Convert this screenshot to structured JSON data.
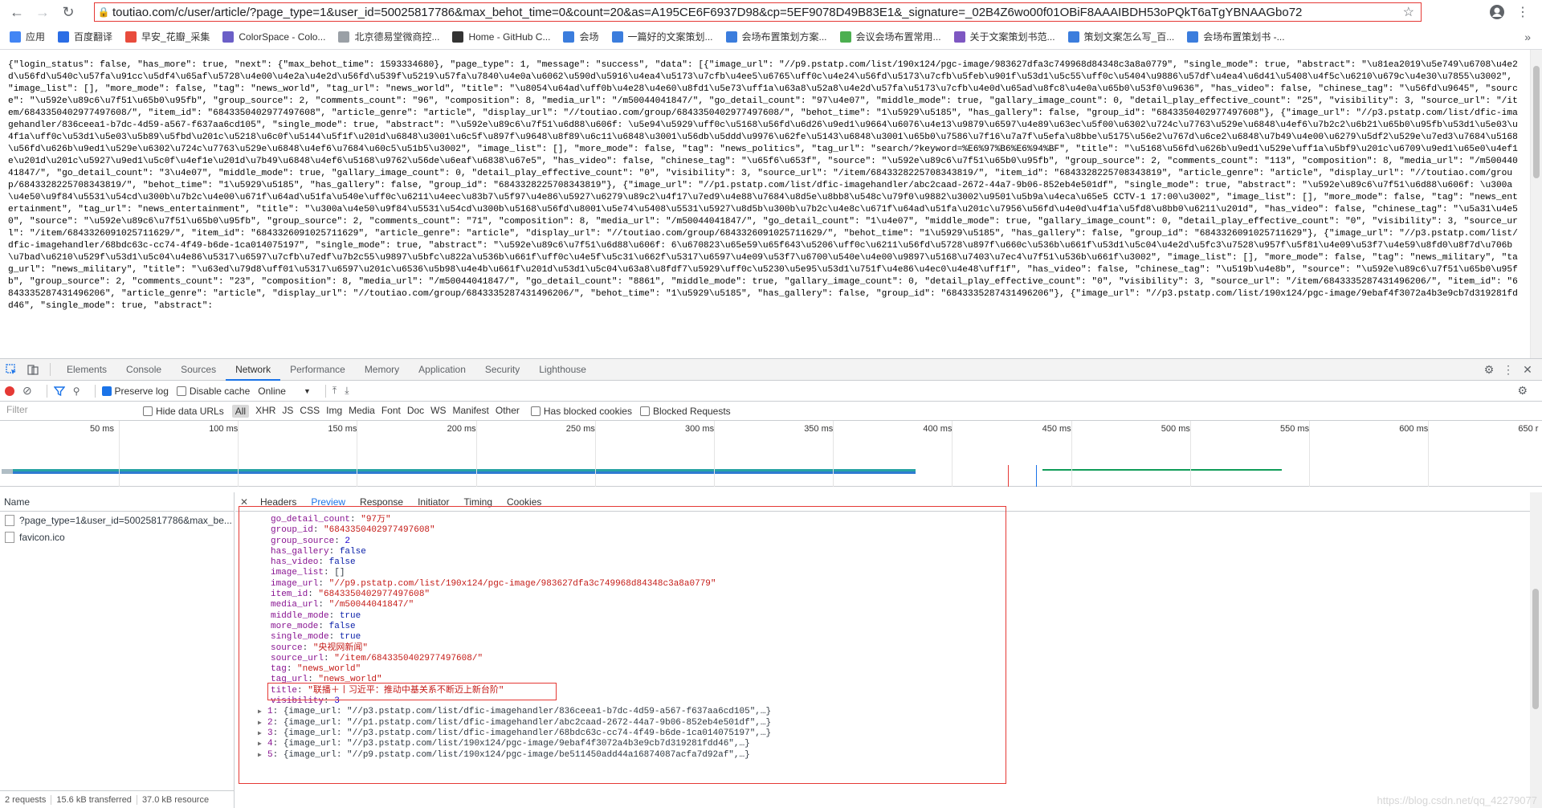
{
  "browser": {
    "url": "toutiao.com/c/user/article/?page_type=1&user_id=50025817786&max_behot_time=0&count=20&as=A195CE6F6937D98&cp=5EF9078D49B83E1&_signature=_02B4Z6wo00f01OBiF8AAAIBDH53oPQkT6aTgYBNAAGbo72",
    "bookmarks": [
      {
        "label": "应用",
        "color": "#4285f4"
      },
      {
        "label": "百度翻译",
        "color": "#2b6de5"
      },
      {
        "label": "早安_花瓣_采集",
        "color": "#e84c3d"
      },
      {
        "label": "ColorSpace - Colo...",
        "color": "#6b5fc7"
      },
      {
        "label": "北京德易堂微商控...",
        "color": "#9aa0a6"
      },
      {
        "label": "Home - GitHub C...",
        "color": "#333333"
      },
      {
        "label": "会场",
        "color": "#3b7ddd"
      },
      {
        "label": "一篇好的文案策划...",
        "color": "#3b7ddd"
      },
      {
        "label": "会场布置策划方案...",
        "color": "#3b7ddd"
      },
      {
        "label": "会议会场布置常用...",
        "color": "#4caf50"
      },
      {
        "label": "关于文案策划书范...",
        "color": "#7e57c2"
      },
      {
        "label": "策划文案怎么写_百...",
        "color": "#3b7ddd"
      },
      {
        "label": "会场布置策划书 -...",
        "color": "#3b7ddd"
      }
    ],
    "more": "»"
  },
  "raw_json": "{\"login_status\": false, \"has_more\": true, \"next\": {\"max_behot_time\": 1593334680}, \"page_type\": 1, \"message\": \"success\", \"data\": [{\"image_url\": \"//p9.pstatp.com/list/190x124/pgc-image/983627dfa3c749968d84348c3a8a0779\", \"single_mode\": true, \"abstract\": \"\\u81ea2019\\u5e749\\u6708\\u4e2d\\u56fd\\u540c\\u57fa\\u91cc\\u5df4\\u65af\\u5728\\u4e00\\u4e2a\\u4e2d\\u56fd\\u539f\\u5219\\u57fa\\u7840\\u4e0a\\u6062\\u590d\\u5916\\u4ea4\\u5173\\u7cfb\\u4ee5\\u6765\\uff0c\\u4e24\\u56fd\\u5173\\u7cfb\\u5feb\\u901f\\u53d1\\u5c55\\uff0c\\u5404\\u9886\\u57df\\u4ea4\\u6d41\\u5408\\u4f5c\\u6210\\u679c\\u4e30\\u7855\\u3002\", \"image_list\": [], \"more_mode\": false, \"tag\": \"news_world\", \"tag_url\": \"news_world\", \"title\": \"\\u8054\\u64ad\\uff0b\\u4e28\\u4e60\\u8fd1\\u5e73\\uff1a\\u63a8\\u52a8\\u4e2d\\u57fa\\u5173\\u7cfb\\u4e0d\\u65ad\\u8fc8\\u4e0a\\u65b0\\u53f0\\u9636\", \"has_video\": false, \"chinese_tag\": \"\\u56fd\\u9645\", \"source\": \"\\u592e\\u89c6\\u7f51\\u65b0\\u95fb\", \"group_source\": 2, \"comments_count\": \"96\", \"composition\": 8, \"media_url\": \"/m50044041847/\", \"go_detail_count\": \"97\\u4e07\", \"middle_mode\": true, \"gallary_image_count\": 0, \"detail_play_effective_count\": \"25\", \"visibility\": 3, \"source_url\": \"/item/6843350402977497608/\", \"item_id\": \"6843350402977497608\", \"article_genre\": \"article\", \"display_url\": \"//toutiao.com/group/6843350402977497608/\", \"behot_time\": \"1\\u5929\\u5185\", \"has_gallery\": false, \"group_id\": \"6843350402977497608\"}, {\"image_url\": \"//p3.pstatp.com/list/dfic-imagehandler/836ceea1-b7dc-4d59-a567-f637aa6cd105\", \"single_mode\": true, \"abstract\": \"\\u592e\\u89c6\\u7f51\\u6d88\\u606f: \\u5e94\\u5929\\uff0c\\u5168\\u56fd\\u6d26\\u9ed1\\u9664\\u6076\\u4e13\\u9879\\u6597\\u4e89\\u63ec\\u5f00\\u6302\\u724c\\u7763\\u529e\\u6848\\u4ef6\\u7b2c2\\u6b21\\u65b0\\u95fb\\u53d1\\u5e03\\u4f1a\\uff0c\\u53d1\\u5e03\\u5b89\\u5fbd\\u201c\\u5218\\u6c0f\\u5144\\u5f1f\\u201d\\u6848\\u3001\\u6c5f\\u897f\\u9648\\u8f89\\u6c11\\u6848\\u3001\\u56db\\u5ddd\\u9976\\u62fe\\u5143\\u6848\\u3001\\u65b0\\u7586\\u7f16\\u7a7f\\u5efa\\u8bbe\\u5175\\u56e2\\u767d\\u6ce2\\u6848\\u7b49\\u4e00\\u6279\\u5df2\\u529e\\u7ed3\\u7684\\u5168\\u56fd\\u626b\\u9ed1\\u529e\\u6302\\u724c\\u7763\\u529e\\u6848\\u4ef6\\u7684\\u60c5\\u51b5\\u3002\", \"image_list\": [], \"more_mode\": false, \"tag\": \"news_politics\", \"tag_url\": \"search/?keyword=%E6%97%B6%E6%94%BF\", \"title\": \"\\u5168\\u56fd\\u626b\\u9ed1\\u529e\\uff1a\\u5bf9\\u201c\\u6709\\u9ed1\\u65e0\\u4ef1e\\u201d\\u201c\\u5927\\u9ed1\\u5c0f\\u4ef1e\\u201d\\u7b49\\u6848\\u4ef6\\u5168\\u9762\\u56de\\u6eaf\\u6838\\u67e5\", \"has_video\": false, \"chinese_tag\": \"\\u65f6\\u653f\", \"source\": \"\\u592e\\u89c6\\u7f51\\u65b0\\u95fb\", \"group_source\": 2, \"comments_count\": \"113\", \"composition\": 8, \"media_url\": \"/m50044041847/\", \"go_detail_count\": \"3\\u4e07\", \"middle_mode\": true, \"gallary_image_count\": 0, \"detail_play_effective_count\": \"0\", \"visibility\": 3, \"source_url\": \"/item/6843328225708343819/\", \"item_id\": \"6843328225708343819\", \"article_genre\": \"article\", \"display_url\": \"//toutiao.com/group/6843328225708343819/\", \"behot_time\": \"1\\u5929\\u5185\", \"has_gallery\": false, \"group_id\": \"6843328225708343819\"}, {\"image_url\": \"//p1.pstatp.com/list/dfic-imagehandler/abc2caad-2672-44a7-9b06-852eb4e501df\", \"single_mode\": true, \"abstract\": \"\\u592e\\u89c6\\u7f51\\u6d88\\u606f: \\u300a\\u4e50\\u9f84\\u5531\\u54cd\\u300b\\u7b2c\\u4e00\\u671f\\u64ad\\u51fa\\u540e\\uff0c\\u6211\\u4eec\\u83b7\\u5f97\\u4e86\\u5927\\u6279\\u89c2\\u4f17\\u7ed9\\u4e88\\u7684\\u8d5e\\u8bb8\\u548c\\u79f0\\u9882\\u3002\\u9501\\u5b9a\\u4eca\\u65e5 CCTV-1 17:00\\u3002\", \"image_list\": [], \"more_mode\": false, \"tag\": \"news_entertainment\", \"tag_url\": \"news_entertainment\", \"title\": \"\\u300a\\u4e50\\u9f84\\u5531\\u54cd\\u300b\\u5168\\u56fd\\u8001\\u5e74\\u5408\\u5531\\u5927\\u8d5b\\u300b\\u7b2c\\u4e8c\\u671f\\u64ad\\u51fa\\u201c\\u7956\\u56fd\\u4e0d\\u4f1a\\u5fd8\\u8bb0\\u6211\\u201d\", \"has_video\": false, \"chinese_tag\": \"\\u5a31\\u4e50\", \"source\": \"\\u592e\\u89c6\\u7f51\\u65b0\\u95fb\", \"group_source\": 2, \"comments_count\": \"71\", \"composition\": 8, \"media_url\": \"/m50044041847/\", \"go_detail_count\": \"1\\u4e07\", \"middle_mode\": true, \"gallary_image_count\": 0, \"detail_play_effective_count\": \"0\", \"visibility\": 3, \"source_url\": \"/item/6843326091025711629/\", \"item_id\": \"6843326091025711629\", \"article_genre\": \"article\", \"display_url\": \"//toutiao.com/group/6843326091025711629/\", \"behot_time\": \"1\\u5929\\u5185\", \"has_gallery\": false, \"group_id\": \"6843326091025711629\"}, {\"image_url\": \"//p3.pstatp.com/list/dfic-imagehandler/68bdc63c-cc74-4f49-b6de-1ca014075197\", \"single_mode\": true, \"abstract\": \"\\u592e\\u89c6\\u7f51\\u6d88\\u606f: 6\\u670823\\u65e59\\u65f643\\u5206\\uff0c\\u6211\\u56fd\\u5728\\u897f\\u660c\\u536b\\u661f\\u53d1\\u5c04\\u4e2d\\u5fc3\\u7528\\u957f\\u5f81\\u4e09\\u53f7\\u4e59\\u8fd0\\u8f7d\\u706b\\u7bad\\u6210\\u529f\\u53d1\\u5c04\\u4e86\\u5317\\u6597\\u7cfb\\u7edf\\u7b2c55\\u9897\\u5bfc\\u822a\\u536b\\u661f\\uff0c\\u4e5f\\u5c31\\u662f\\u5317\\u6597\\u4e09\\u53f7\\u6700\\u540e\\u4e00\\u9897\\u5168\\u7403\\u7ec4\\u7f51\\u536b\\u661f\\u3002\", \"image_list\": [], \"more_mode\": false, \"tag\": \"news_military\", \"tag_url\": \"news_military\", \"title\": \"\\u63ed\\u79d8\\uff01\\u5317\\u6597\\u201c\\u6536\\u5b98\\u4e4b\\u661f\\u201d\\u53d1\\u5c04\\u63a8\\u8fdf7\\u5929\\uff0c\\u5230\\u5e95\\u53d1\\u751f\\u4e86\\u4ec0\\u4e48\\uff1f\", \"has_video\": false, \"chinese_tag\": \"\\u519b\\u4e8b\", \"source\": \"\\u592e\\u89c6\\u7f51\\u65b0\\u95fb\", \"group_source\": 2, \"comments_count\": \"23\", \"composition\": 8, \"media_url\": \"/m50044041847/\", \"go_detail_count\": \"8861\", \"middle_mode\": true, \"gallary_image_count\": 0, \"detail_play_effective_count\": \"0\", \"visibility\": 3, \"source_url\": \"/item/6843335287431496206/\", \"item_id\": \"6843335287431496206\", \"article_genre\": \"article\", \"display_url\": \"//toutiao.com/group/6843335287431496206/\", \"behot_time\": \"1\\u5929\\u5185\", \"has_gallery\": false, \"group_id\": \"6843335287431496206\"}, {\"image_url\": \"//p3.pstatp.com/list/190x124/pgc-image/9ebaf4f3072a4b3e9cb7d319281fdd46\", \"single_mode\": true, \"abstract\":",
  "devtools": {
    "tabs": [
      "Elements",
      "Console",
      "Sources",
      "Network",
      "Performance",
      "Memory",
      "Application",
      "Security",
      "Lighthouse"
    ],
    "active_tab": "Network",
    "toolbar": {
      "preserve_log": "Preserve log",
      "disable_cache": "Disable cache",
      "throttle": "Online"
    },
    "filter": {
      "placeholder": "Filter",
      "hide_data_urls": "Hide data URLs",
      "types": [
        "All",
        "XHR",
        "JS",
        "CSS",
        "Img",
        "Media",
        "Font",
        "Doc",
        "WS",
        "Manifest",
        "Other"
      ],
      "has_blocked_cookies": "Has blocked cookies",
      "blocked_requests": "Blocked Requests"
    },
    "timeline_ticks": [
      "50 ms",
      "100 ms",
      "150 ms",
      "200 ms",
      "250 ms",
      "300 ms",
      "350 ms",
      "400 ms",
      "450 ms",
      "500 ms",
      "550 ms",
      "600 ms",
      "650 r"
    ],
    "name_header": "Name",
    "requests": [
      "?page_type=1&user_id=50025817786&max_be...",
      "favicon.ico"
    ],
    "footer": {
      "requests": "2 requests",
      "transferred": "15.6 kB transferred",
      "resources": "37.0 kB resource"
    },
    "detail_tabs": [
      "Headers",
      "Preview",
      "Response",
      "Initiator",
      "Timing",
      "Cookies"
    ],
    "active_detail_tab": "Preview",
    "preview_lines": [
      {
        "k": "go_detail_count",
        "v": "\"97万\"",
        "t": "s"
      },
      {
        "k": "group_id",
        "v": "\"6843350402977497608\"",
        "t": "s"
      },
      {
        "k": "group_source",
        "v": "2",
        "t": "n"
      },
      {
        "k": "has_gallery",
        "v": "false",
        "t": "b"
      },
      {
        "k": "has_video",
        "v": "false",
        "t": "b"
      },
      {
        "k": "image_list",
        "v": "[]",
        "t": "p"
      },
      {
        "k": "image_url",
        "v": "\"//p9.pstatp.com/list/190x124/pgc-image/983627dfa3c749968d84348c3a8a0779\"",
        "t": "s"
      },
      {
        "k": "item_id",
        "v": "\"6843350402977497608\"",
        "t": "s"
      },
      {
        "k": "media_url",
        "v": "\"/m50044041847/\"",
        "t": "s"
      },
      {
        "k": "middle_mode",
        "v": "true",
        "t": "b"
      },
      {
        "k": "more_mode",
        "v": "false",
        "t": "b"
      },
      {
        "k": "single_mode",
        "v": "true",
        "t": "b"
      },
      {
        "k": "source",
        "v": "\"央视网新闻\"",
        "t": "s"
      },
      {
        "k": "source_url",
        "v": "\"/item/6843350402977497608/\"",
        "t": "s"
      },
      {
        "k": "tag",
        "v": "\"news_world\"",
        "t": "s"
      },
      {
        "k": "tag_url",
        "v": "\"news_world\"",
        "t": "s"
      },
      {
        "k": "title",
        "v": "\"联播＋丨习近平：推动中基关系不断迈上新台阶\"",
        "t": "s"
      },
      {
        "k": "visibility",
        "v": "3",
        "t": "n"
      }
    ],
    "collapsed_items": [
      {
        "idx": "1",
        "v": "{image_url: \"//p3.pstatp.com/list/dfic-imagehandler/836ceea1-b7dc-4d59-a567-f637aa6cd105\",…}"
      },
      {
        "idx": "2",
        "v": "{image_url: \"//p1.pstatp.com/list/dfic-imagehandler/abc2caad-2672-44a7-9b06-852eb4e501df\",…}"
      },
      {
        "idx": "3",
        "v": "{image_url: \"//p3.pstatp.com/list/dfic-imagehandler/68bdc63c-cc74-4f49-b6de-1ca014075197\",…}"
      },
      {
        "idx": "4",
        "v": "{image_url: \"//p3.pstatp.com/list/190x124/pgc-image/9ebaf4f3072a4b3e9cb7d319281fdd46\",…}"
      },
      {
        "idx": "5",
        "v": "{image_url: \"//p9.pstatp.com/list/190x124/pgc-image/be511450add44a16874087acfa7d92af\",…}"
      }
    ],
    "watermark": "https://blog.csdn.net/qq_42279077"
  }
}
